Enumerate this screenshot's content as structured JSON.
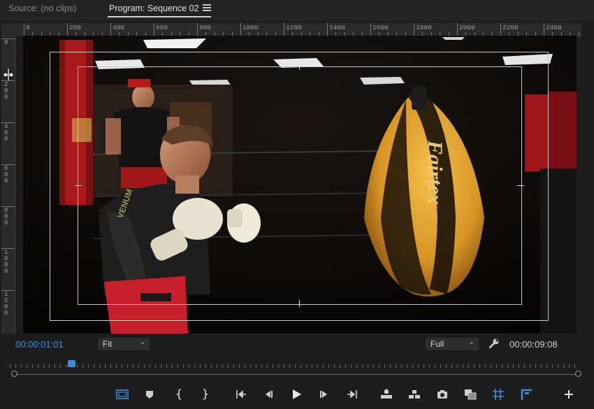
{
  "tabs": {
    "source": "Source: (no clips)",
    "program": "Program: Sequence 02"
  },
  "ruler": {
    "top_labels": [
      "0",
      "200",
      "400",
      "600",
      "800",
      "1000",
      "1200",
      "1400",
      "1600",
      "1800",
      "2000",
      "2200",
      "2400"
    ],
    "left_labels": [
      "0",
      "200",
      "400",
      "600",
      "800",
      "1000",
      "1200"
    ]
  },
  "monitor": {
    "current_timecode": "00:00:01:01",
    "duration_timecode": "00:00:09:08",
    "zoom": "Fit",
    "resolution": "Full",
    "playhead_fraction": 0.11
  },
  "scene": {
    "bag_text": "Fairtex",
    "trunks_text": "VENUM"
  },
  "colors": {
    "accent": "#3b8ee0",
    "bag_yellow": "#e3a52f",
    "trunks_red": "#c8202a"
  },
  "transport_icons": [
    "safe-margins-icon",
    "add-marker-icon",
    "mark-in-icon",
    "mark-out-icon",
    "go-to-in-icon",
    "step-back-icon",
    "play-icon",
    "step-forward-icon",
    "go-to-out-icon",
    "lift-icon",
    "extract-icon",
    "export-frame-icon",
    "compare-view-icon",
    "rulers-icon",
    "guides-icon",
    "add-button-icon"
  ]
}
